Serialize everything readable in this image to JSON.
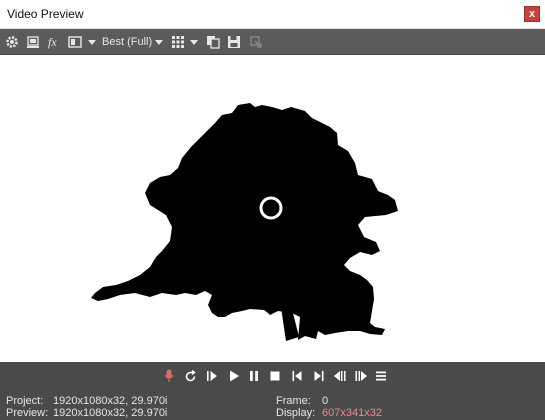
{
  "window": {
    "title": "Video Preview",
    "close_label": "x"
  },
  "toolbar": {
    "quality": "Best (Full)",
    "icons": [
      "gear-icon",
      "preview-props-icon",
      "fx-icon",
      "split-screen-icon",
      "dropdown-icon",
      "grid-icon",
      "copy-snapshot-icon",
      "save-snapshot-icon",
      "external-monitor-icon"
    ]
  },
  "transport": {
    "icons": [
      "record-icon",
      "loop-icon",
      "play-from-start-icon",
      "play-icon",
      "pause-icon",
      "stop-icon",
      "previous-frame-icon",
      "next-frame-icon",
      "step-back-icon",
      "step-forward-icon",
      "menu-icon"
    ],
    "colors": {
      "record": "#e06c67"
    }
  },
  "status": {
    "project_label": "Project:",
    "project_value": "1920x1080x32, 29.970i",
    "preview_label": "Preview:",
    "preview_value": "1920x1080x32, 29.970i",
    "frame_label": "Frame:",
    "frame_value": "0",
    "display_label": "Display:",
    "display_value": "607x341x32"
  }
}
